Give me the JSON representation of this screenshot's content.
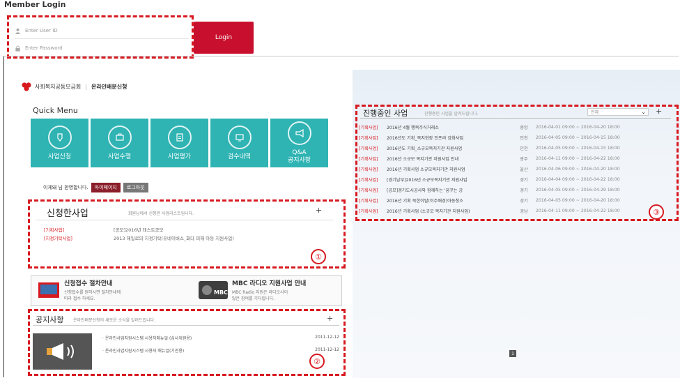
{
  "page": {
    "title": "Member Login"
  },
  "login": {
    "user_placeholder": "Enter User ID",
    "pass_placeholder": "Enter Password",
    "button_label": "Login"
  },
  "header": {
    "org_name": "사회복지공동모금회",
    "service_name": "온라인배분신청"
  },
  "quick_menu": {
    "title": "Quick Menu",
    "items": [
      {
        "label": "사업신청",
        "icon": "pen-icon"
      },
      {
        "label": "사업수행",
        "icon": "briefcase-icon"
      },
      {
        "label": "사업평가",
        "icon": "clipboard-icon"
      },
      {
        "label": "검수내역",
        "icon": "monitor-icon"
      },
      {
        "label": "Q&A\n공지사항",
        "icon": "megaphone-icon"
      }
    ]
  },
  "welcome": {
    "text": "이게돼 님 환영합니다.",
    "mypage_label": "마이페이지",
    "logout_label": "로그아웃"
  },
  "applied": {
    "title": "신청한사업",
    "subtitle": "회원님께서 신청한 사업리스트입니다.",
    "plus": "+",
    "badge": "①",
    "rows": [
      {
        "category": "[기획사업]",
        "title": "[공모]2016년 테스트공모"
      },
      {
        "category": "[지정기탁사업]",
        "title": "2013 해일로의 지정기탁(유네이버스_화다 피해 아동 지원사업)"
      }
    ]
  },
  "info_cards": [
    {
      "title": "신청접수 절차안내",
      "desc": "신청접수를 원하시면 절차안내에\n따라 접수 하세요."
    },
    {
      "title": "MBC 라디오 지원사업 안내",
      "desc": "MBC Radio 지원은 라디오사이\n많은 참여를 기다립니다."
    }
  ],
  "notices": {
    "title": "공지사항",
    "subtitle": "온라인배분신청의 새로운 소식을 알려드립니다.",
    "plus": "+",
    "badge": "②",
    "rows": [
      {
        "title": "· 온라인사업지원시스템 사용자매뉴얼 (심사위원용)",
        "date": "2011-12-12"
      },
      {
        "title": "· 온라인사업지원시스템 사용자 매뉴얼(기관용)",
        "date": "2011-12-12"
      }
    ]
  },
  "progress": {
    "title": "진행중인 사업",
    "subtitle": "진행중인 사업을 알려드립니다.",
    "select_value": "전체",
    "plus": "+",
    "badge": "③",
    "rows": [
      {
        "category": "[기획사업]",
        "title": "2016년 4월 행복주식거래소",
        "region": "중앙",
        "period": "2016-04-01 09:00 ~ 2016-04-20 18:00"
      },
      {
        "category": "[기획사업]",
        "title": "2016년도 기획_복지현장 인프라 강화사업",
        "region": "인천",
        "period": "2016-04-05 09:00 ~ 2016-04-15 18:00"
      },
      {
        "category": "[기획사업]",
        "title": "2016년도 기획_소규모복지기관 지원사업",
        "region": "인천",
        "period": "2016-04-05 09:00 ~ 2016-04-15 18:00"
      },
      {
        "category": "[기획사업]",
        "title": "2016년 소규모 복지기관 지원사업 안내",
        "region": "광주",
        "period": "2016-04-11 09:00 ~ 2016-04-22 18:00"
      },
      {
        "category": "[기획사업]",
        "title": "2016년 기획사업 소규모복지기관 지원사업",
        "region": "울산",
        "period": "2016-04-06 09:00 ~ 2016-04-20 18:00"
      },
      {
        "category": "[기획사업]",
        "title": "[경기남부]2016년 소규모복지기관 지원사업",
        "region": "경기",
        "period": "2016-04-04 09:00 ~ 2016-04-22 18:00"
      },
      {
        "category": "[기획사업]",
        "title": "[공모]경기도시공사와 함께하는 '꿈꾸는 공",
        "region": "경기",
        "period": "2016-04-05 09:00 ~ 2016-04-29 18:00"
      },
      {
        "category": "[기획사업]",
        "title": "2016년 기획 북한이탈(이주배경)아동청소",
        "region": "경기",
        "period": "2016-04-05 09:00 ~ 2016-04-20 18:00"
      },
      {
        "category": "[기획사업]",
        "title": "2016년 기획사업 (소규모 복지기관 지원사업)",
        "region": "경남",
        "period": "2016-04-11 09:00 ~ 2016-04-22 18:00"
      }
    ]
  },
  "pagination": {
    "current": "1"
  },
  "colors": {
    "accent_red": "#d71920",
    "login_red": "#c8102e",
    "tile_teal": "#2fb3b3"
  }
}
